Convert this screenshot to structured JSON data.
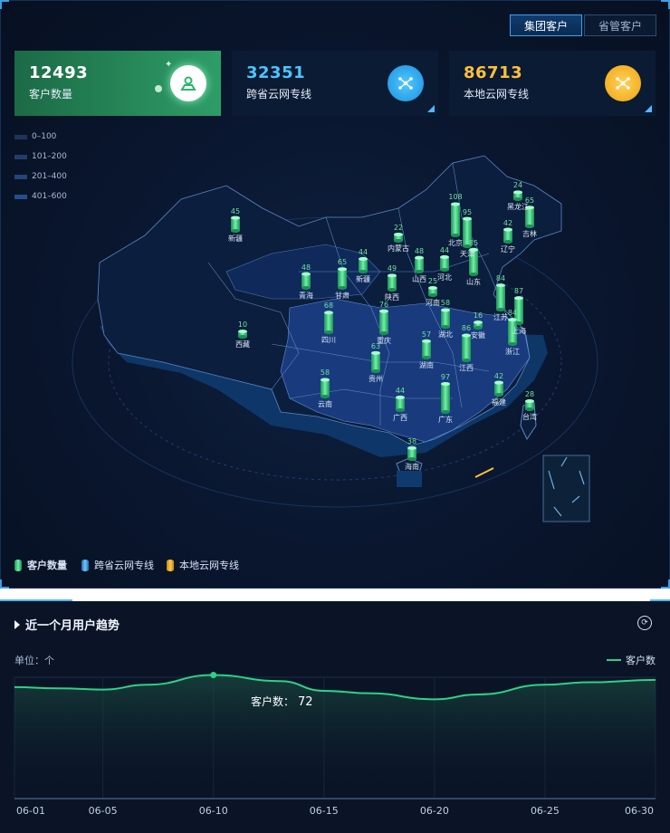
{
  "tabs": {
    "group": "集团客户",
    "provincial": "省管客户"
  },
  "stats": [
    {
      "value": "12493",
      "label": "客户数量",
      "color": "#ffffff",
      "icon": "user-icon"
    },
    {
      "value": "32351",
      "label": "跨省云网专线",
      "color": "#4fc4ff",
      "icon": "network-icon"
    },
    {
      "value": "86713",
      "label": "本地云网专线",
      "color": "#ffc03d",
      "icon": "network-icon"
    }
  ],
  "range_legend": [
    "0–100",
    "101–200",
    "201–400",
    "401–600"
  ],
  "map_legend": [
    "客户数量",
    "跨省云网专线",
    "本地云网专线"
  ],
  "provinces": [
    {
      "name": "新疆",
      "value": "45"
    },
    {
      "name": "西藏",
      "value": "10"
    },
    {
      "name": "青海",
      "value": "48"
    },
    {
      "name": "甘肃",
      "value": "65"
    },
    {
      "name": "新疆",
      "value": "44"
    },
    {
      "name": "陕西",
      "value": "49"
    },
    {
      "name": "内蒙古",
      "value": "22"
    },
    {
      "name": "山西",
      "value": "48"
    },
    {
      "name": "河北",
      "value": "44"
    },
    {
      "name": "北京",
      "value": "108"
    },
    {
      "name": "天津",
      "value": "95"
    },
    {
      "name": "辽宁",
      "value": "42"
    },
    {
      "name": "吉林",
      "value": "65"
    },
    {
      "name": "黑龙江",
      "value": "24"
    },
    {
      "name": "山东",
      "value": "85"
    },
    {
      "name": "河南",
      "value": "25"
    },
    {
      "name": "四川",
      "value": "68"
    },
    {
      "name": "重庆",
      "value": "76"
    },
    {
      "name": "湖北",
      "value": "58"
    },
    {
      "name": "安徽",
      "value": "16"
    },
    {
      "name": "江苏",
      "value": "84"
    },
    {
      "name": "上海",
      "value": "87"
    },
    {
      "name": "浙江",
      "value": "84"
    },
    {
      "name": "湖南",
      "value": "57"
    },
    {
      "name": "江西",
      "value": "86"
    },
    {
      "name": "贵州",
      "value": "63"
    },
    {
      "name": "云南",
      "value": "58"
    },
    {
      "name": "广西",
      "value": "44"
    },
    {
      "name": "广东",
      "value": "97"
    },
    {
      "name": "福建",
      "value": "42"
    },
    {
      "name": "台湾",
      "value": "28"
    },
    {
      "name": "海南",
      "value": "38"
    }
  ],
  "trend": {
    "title": "近一个月用户趋势",
    "unit_label": "单位：个",
    "tooltip_label": "客户数：",
    "tooltip_value": "72",
    "chart_data": {
      "type": "area",
      "series": [
        {
          "name": "客户数",
          "color": "#2fd087"
        }
      ],
      "x": [
        "06-01",
        "06-03",
        "06-05",
        "06-07",
        "06-10",
        "06-13",
        "06-15",
        "06-17",
        "06-20",
        "06-22",
        "06-25",
        "06-27",
        "06-30"
      ],
      "values": [
        62,
        61,
        60,
        64,
        72,
        67,
        59,
        57,
        52,
        56,
        64,
        66,
        68
      ],
      "x_tick_labels": [
        "06-01",
        "06-05",
        "06-10",
        "06-15",
        "06-20",
        "06-25",
        "06-30"
      ],
      "highlight": {
        "x": "06-10",
        "value": 72
      }
    }
  }
}
